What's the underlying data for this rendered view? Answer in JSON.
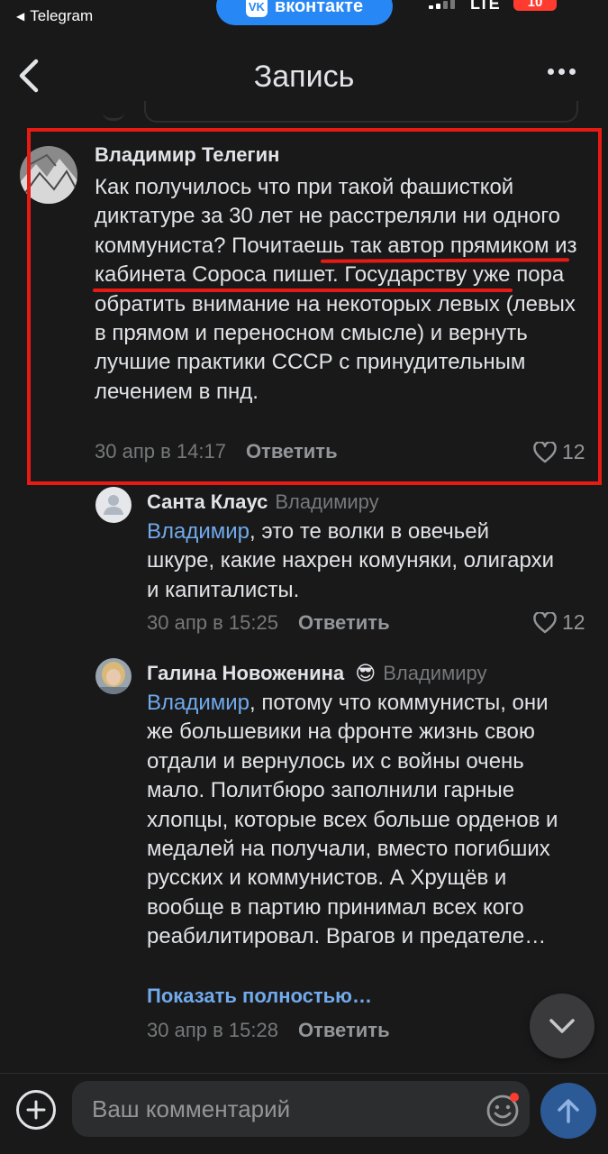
{
  "status_bar": {
    "back_app_label": "Telegram",
    "vk_pill_label": "вконтакте",
    "network": "LTE",
    "battery": "10"
  },
  "header": {
    "title": "Запись"
  },
  "comments": [
    {
      "author": "Владимир Телегин",
      "text_part1": "Как получилось что при такой фашисткой диктатуре за 30 лет не расстреляли ни одного коммуниста? ",
      "text_part2": "Почитаешь так автор прямиком из кабинета Сороса пишет",
      "text_part3": ". Государству уже пора обратить внимание на некоторых левых (левых в прямом и переносном смысле) и вернуть лучшие практики СССР с принудительным лечением в пнд.",
      "date": "30 апр в 14:17",
      "reply_label": "Ответить",
      "likes": "12"
    },
    {
      "author": "Санта Клаус",
      "reply_to": "Владимиру",
      "mention": "Владимир",
      "text": ", это те волки в овечьей шкуре, какие нахрен комуняки, олигархи и капиталисты.",
      "date": "30 апр в 15:25",
      "reply_label": "Ответить",
      "likes": "12"
    },
    {
      "author": "Галина Новоженина",
      "author_emoji": "😎",
      "reply_to": "Владимиру",
      "mention": "Владимир",
      "text": ", потому что коммунисты, они же большевики на фронте жизнь свою отдали и вернулось их с войны очень мало. Политбюро заполнили гарные хлопцы, которые всех больше орденов и медалей  на получали, вместо погибших русских и коммунистов. А Хрущёв и вообще в партию принимал всех кого реабилитировал. Врагов и предателе…",
      "show_more": "Показать полностью…",
      "date": "30 апр в 15:28",
      "reply_label": "Ответить"
    }
  ],
  "composer": {
    "placeholder": "Ваш комментарий"
  },
  "colors": {
    "background": "#19191a",
    "link": "#71aaeb",
    "annotation": "#e81b14",
    "vk_blue": "#2787f5"
  }
}
